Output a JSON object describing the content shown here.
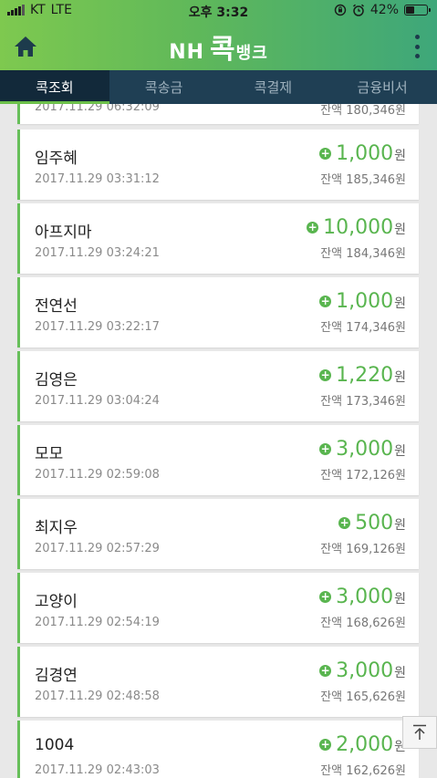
{
  "status": {
    "carrier": "KT",
    "network": "LTE",
    "time": "오후 3:32",
    "battery": "42%",
    "battery_level": 0.42
  },
  "header": {
    "logo_nh": "NH",
    "logo_kok": "콕",
    "logo_bank": "뱅크",
    "icons": {
      "home": "home-icon",
      "menu": "kebab-menu-icon"
    }
  },
  "tabs": [
    {
      "label": "콕조회",
      "active": true
    },
    {
      "label": "콕송금",
      "active": false
    },
    {
      "label": "콕결제",
      "active": false
    },
    {
      "label": "금융비서",
      "active": false
    }
  ],
  "partial_top": {
    "date": "2017.11.29 06:32:09",
    "balance": "잔액 180,346원"
  },
  "transactions": [
    {
      "name": "임주혜",
      "date": "2017.11.29 03:31:12",
      "amount": "1,000",
      "unit": "원",
      "balance": "잔액 185,346원"
    },
    {
      "name": "아프지마",
      "date": "2017.11.29 03:24:21",
      "amount": "10,000",
      "unit": "원",
      "balance": "잔액 184,346원"
    },
    {
      "name": "전연선",
      "date": "2017.11.29 03:22:17",
      "amount": "1,000",
      "unit": "원",
      "balance": "잔액 174,346원"
    },
    {
      "name": "김영은",
      "date": "2017.11.29 03:04:24",
      "amount": "1,220",
      "unit": "원",
      "balance": "잔액 173,346원"
    },
    {
      "name": "모모",
      "date": "2017.11.29 02:59:08",
      "amount": "3,000",
      "unit": "원",
      "balance": "잔액 172,126원"
    },
    {
      "name": "최지우",
      "date": "2017.11.29 02:57:29",
      "amount": "500",
      "unit": "원",
      "balance": "잔액 169,126원"
    },
    {
      "name": "고양이",
      "date": "2017.11.29 02:54:19",
      "amount": "3,000",
      "unit": "원",
      "balance": "잔액 168,626원"
    },
    {
      "name": "김경연",
      "date": "2017.11.29 02:48:58",
      "amount": "3,000",
      "unit": "원",
      "balance": "잔액 165,626원"
    },
    {
      "name": "1004",
      "date": "2017.11.29 02:43:03",
      "amount": "2,000",
      "unit": "원",
      "balance": "잔액 162,626원"
    }
  ],
  "scroll_top_icon": "arrow-up-icon",
  "colors": {
    "accent": "#59b54f",
    "tabbar": "#1f3f54",
    "tab_active": "#12293a"
  }
}
